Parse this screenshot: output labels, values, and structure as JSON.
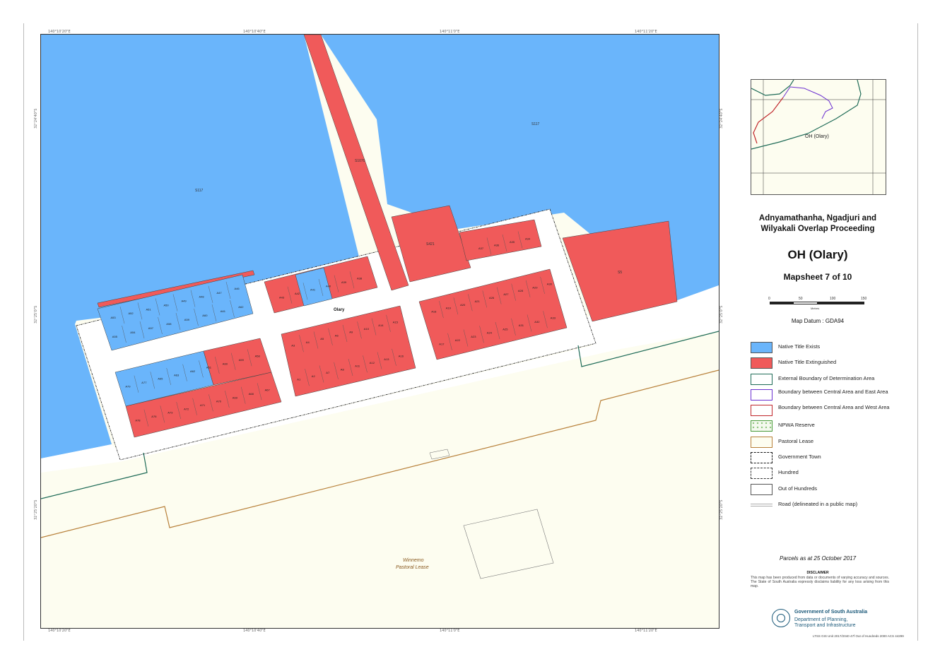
{
  "coords": {
    "top": [
      "140°10'20\"E",
      "140°10'40\"E",
      "140°11'0\"E",
      "140°11'20\"E"
    ],
    "bottom": [
      "140°10'20\"E",
      "140°10'40\"E",
      "140°11'0\"E",
      "140°11'20\"E"
    ],
    "left": [
      "32°24'40\"S",
      "32°25'0\"S",
      "32°25'20\"S"
    ],
    "right": [
      "32°24'40\"S",
      "32°25'0\"S",
      "32°25'20\"S"
    ]
  },
  "map": {
    "labels": {
      "sec117_west": "S117",
      "sec117_east": "S117",
      "corridor": "S1070",
      "block_top": "S421",
      "block_east": "S5",
      "town": "Olary",
      "pastoral_name": "Winnemo",
      "pastoral_type": "Pastoral Lease"
    },
    "colors": {
      "native_title_exists": "#6ab5fb",
      "native_title_extinguished": "#f05a5a",
      "land": "#fdfdf0",
      "external_boundary": "#1e6b57",
      "east_boundary": "#6b2fd0",
      "west_boundary": "#c0262b",
      "pastoral_lease": "#b8803a"
    },
    "allotments": {
      "nw_top": [
        "A53",
        "A52",
        "A51",
        "A50",
        "A49",
        "A48",
        "A47",
        "A46"
      ],
      "nw_mid": [
        "A55",
        "A54",
        "A57",
        "A58",
        "A59",
        "A60",
        "A61",
        "A62"
      ],
      "sw_top": [
        "A79",
        "A77",
        "A65",
        "A63",
        "A62",
        "A61",
        "A60",
        "A59",
        "A58"
      ],
      "sw_bot": [
        "A78",
        "A76",
        "A73",
        "A72",
        "A71",
        "A70",
        "A69",
        "A68",
        "A67"
      ],
      "c_top": [
        "A43",
        "A42",
        "A41",
        "A40",
        "A39",
        "A38"
      ],
      "c_upper": [
        "A3",
        "A4",
        "A5",
        "A6",
        "A9",
        "A10",
        "A14",
        "A15"
      ],
      "c_lower": [
        "A1",
        "A2",
        "A7",
        "A8",
        "A11",
        "A12",
        "A13",
        "A16"
      ],
      "e_upper": [
        "A18",
        "A19",
        "A20",
        "A21",
        "A26",
        "A27",
        "A28",
        "A29",
        "A30"
      ],
      "e_lower": [
        "A17",
        "A22",
        "A23",
        "A24",
        "A25",
        "A31",
        "A32",
        "A33"
      ],
      "ne_block": [
        "A37",
        "A36",
        "A35",
        "A34"
      ]
    }
  },
  "inset": {
    "label": "OH (Olary)"
  },
  "titles": {
    "line1": "Adnyamathanha, Ngadjuri and",
    "line2": "Wilyakali Overlap Proceeding",
    "main": "OH (Olary)",
    "mapsheet": "Mapsheet 7 of 10"
  },
  "scale": {
    "ticks": [
      "0",
      "50",
      "100",
      "150"
    ],
    "unit": "Metres"
  },
  "datum": "Map Datum : GDA94",
  "legend": [
    {
      "label": "Native Title Exists",
      "icon": "blue-fill-swatch"
    },
    {
      "label": "Native Title Extinguished",
      "icon": "red-fill-swatch"
    },
    {
      "label": "External Boundary of Determination Area",
      "icon": "green-outline-swatch"
    },
    {
      "label": "Boundary between Central Area and East Area",
      "icon": "purple-outline-swatch"
    },
    {
      "label": "Boundary between Central Area and West Area",
      "icon": "red-outline-swatch"
    },
    {
      "label": "NPWA Reserve",
      "icon": "green-dotted-swatch"
    },
    {
      "label": "Pastoral Lease",
      "icon": "brown-outline-swatch"
    },
    {
      "label": "Government Town",
      "icon": "dash-dot-swatch"
    },
    {
      "label": "Hundred",
      "icon": "dashed-swatch"
    },
    {
      "label": "Out of Hundreds",
      "icon": "grey-outline-swatch"
    },
    {
      "label": "Road (delineated in a public map)",
      "icon": "double-line-swatch"
    }
  ],
  "parcels_note": "Parcels as at 25 October 2017",
  "disclaimer": {
    "heading": "DISCLAIMER",
    "text": "This map has been produced from data or documents of varying accuracy and sources. The State of South Australia expressly disclaims liability for any loss arising from this map."
  },
  "logo": {
    "line1": "Government of South Australia",
    "line2": "Department of Planning,",
    "line3": "Transport and Infrastructure"
  },
  "footer_ref": "LTSS GIS Unit 2017/2040 47f Out of Hundreds 2000 ACS 44299"
}
